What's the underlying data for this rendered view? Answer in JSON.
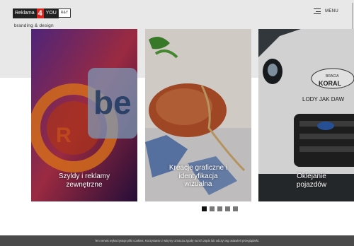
{
  "header": {
    "logo_text": "Reklama",
    "logo_number": "4",
    "logo_suffix": "YOU",
    "badge_text": "R&Y",
    "tagline": "branding & design",
    "menu_label": "MENU"
  },
  "cards": [
    {
      "label_line1": "Szyldy i reklamy",
      "label_line2": "zewnętrzne",
      "label_line3": ""
    },
    {
      "label_line1": "Kreacje graficzne i",
      "label_line2": "identyfikacja",
      "label_line3": "wizualna"
    },
    {
      "label_line1": "Oklejanie",
      "label_line2": "pojazdów",
      "label_line3": ""
    }
  ],
  "car_sign": {
    "line1": "BRACIA",
    "line2": "KORAL",
    "line3": "LODY JAK DAW"
  },
  "pagination": {
    "total": 5,
    "active": 1
  },
  "cookie_notice": "Ten serwis wykorzystuje pliki cookies. Korzystanie z witryny oznacza zgodę na ich zapis lub odczyt wg ustawień przeglądarki.",
  "colors": {
    "accent": "#d7261f",
    "cookie_bar": "#4a4a4a",
    "hero_band": "#e8e8e8"
  }
}
